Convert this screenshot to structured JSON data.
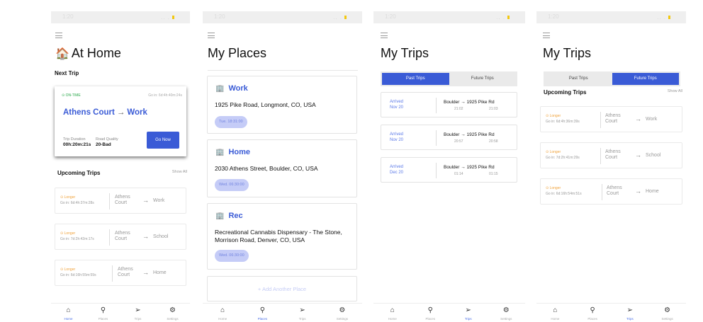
{
  "status_bar": {
    "time": "1:20",
    "signal": "..  ."
  },
  "tabs": [
    {
      "label": "Home",
      "icon": "home-icon",
      "glyph": "⌂"
    },
    {
      "label": "Places",
      "icon": "location-pin-icon",
      "glyph": "⚲"
    },
    {
      "label": "Trips",
      "icon": "send-icon",
      "glyph": "➢"
    },
    {
      "label": "Settings",
      "icon": "gear-icon",
      "glyph": "⚙"
    }
  ],
  "home": {
    "title": "At Home",
    "house_emoji": "🏠",
    "next_trip_label": "Next Trip",
    "next_trip": {
      "status": "ON-TIME",
      "go_in": "Go in: 6d:4h:40m:24s",
      "from": "Athens Court",
      "arrow": "→",
      "to": "Work",
      "duration_label": "Trip Duration",
      "duration": "00h:20m:21s",
      "quality_label": "Road Quality",
      "quality": "20-Bad",
      "go_now": "Go Now"
    },
    "upcoming_label": "Upcoming Trips",
    "show_all": "Show All",
    "upcoming": [
      {
        "status": "Longer",
        "go_in": "Go in: 6d:4h:37m:28s",
        "from1": "Athens",
        "from2": "Court",
        "arrow": "→",
        "to": "Work"
      },
      {
        "status": "Longer",
        "go_in": "Go in: 7d:2h:42m:17s",
        "from1": "Athens",
        "from2": "Court",
        "arrow": "→",
        "to": "School"
      },
      {
        "status": "Longer",
        "go_in": "Go in: 6d:16h:55m:59s",
        "from1": "Athens",
        "from2": "Court",
        "arrow": "→",
        "to": "Home"
      }
    ]
  },
  "places": {
    "title": "My Places",
    "items": [
      {
        "name": "Work",
        "address": "1925 Pike Road, Longmont, CO, USA",
        "time": "Tue. 18:31:00"
      },
      {
        "name": "Home",
        "address": "2030 Athens Street, Boulder, CO, USA",
        "time": "Wed. 06:30:00"
      },
      {
        "name": "Rec",
        "address": "Recreational Cannabis Dispensary - The Stone, Morrison Road, Denver, CO, USA",
        "time": "Wed. 06:30:00"
      }
    ],
    "add_label": "+ Add Another Place"
  },
  "trips_past": {
    "title": "My Trips",
    "tab_past": "Past Trips",
    "tab_future": "Future Trips",
    "items": [
      {
        "arrived": "Arrived",
        "date": "Nov 20",
        "from": "Boulder",
        "arrow": "→",
        "to": "1925 Pike Rd",
        "t1": "21:02",
        "t2": "21:03"
      },
      {
        "arrived": "Arrived",
        "date": "Nov 20",
        "from": "Boulder",
        "arrow": "→",
        "to": "1925 Pike Rd",
        "t1": "20:57",
        "t2": "20:58"
      },
      {
        "arrived": "Arrived",
        "date": "Dec 20",
        "from": "Boulder",
        "arrow": "→",
        "to": "1925 Pike Rd",
        "t1": "01:14",
        "t2": "01:15"
      }
    ]
  },
  "trips_future": {
    "title": "My Trips",
    "tab_past": "Past Trips",
    "tab_future": "Future Trips",
    "upcoming_label": "Upcoming Trips",
    "show_all": "Show All",
    "items": [
      {
        "status": "Longer",
        "go_in": "Go in: 6d:4h:36m:39s",
        "from1": "Athens",
        "from2": "Court",
        "arrow": "→",
        "to": "Work"
      },
      {
        "status": "Longer",
        "go_in": "Go in: 7d:2h:41m:29s",
        "from1": "Athens",
        "from2": "Court",
        "arrow": "→",
        "to": "School"
      },
      {
        "status": "Longer",
        "go_in": "Go in: 6d:16h:54m:51s",
        "from1": "Athens",
        "from2": "Court",
        "arrow": "→",
        "to": "Home"
      }
    ]
  },
  "colors": {
    "accent": "#3a5bd6",
    "ontime": "#2aa84a",
    "longer": "#f0a23a",
    "pill": "#c5ccf7"
  }
}
